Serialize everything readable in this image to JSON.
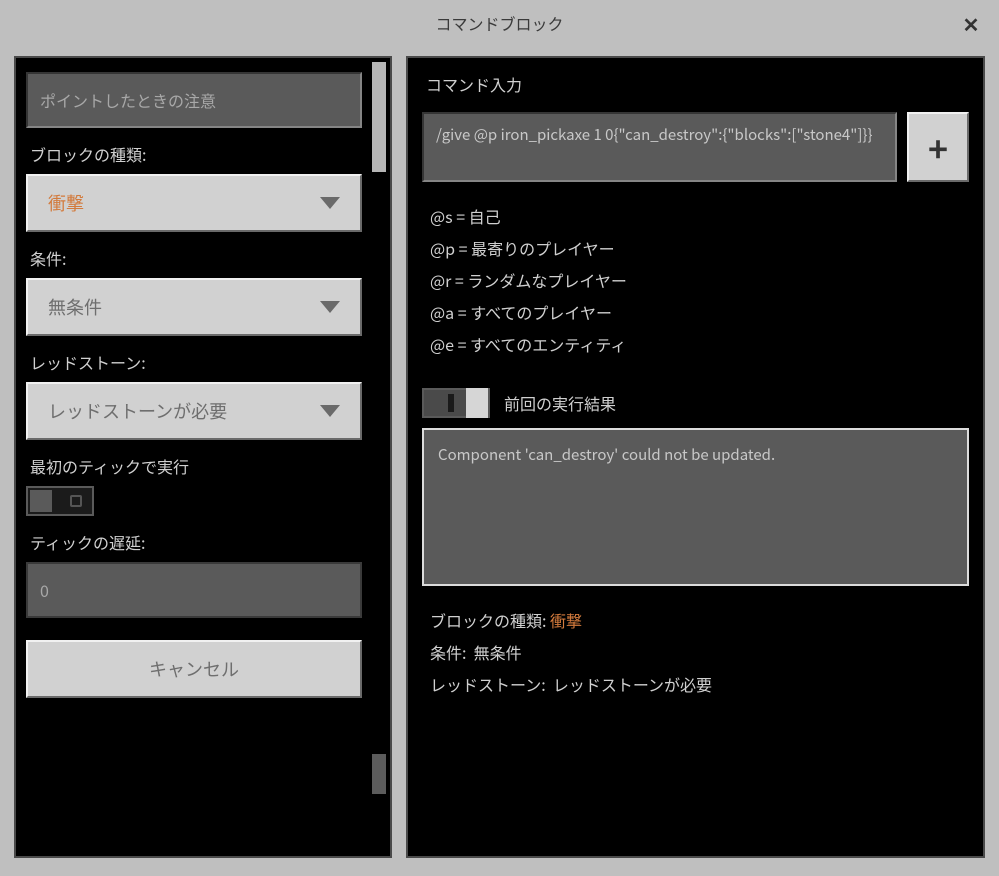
{
  "window": {
    "title": "コマンドブロック"
  },
  "left": {
    "hover_note_placeholder": "ポイントしたときの注意",
    "block_type_label": "ブロックの種類:",
    "block_type_value": "衝撃",
    "condition_label": "条件:",
    "condition_value": "無条件",
    "redstone_label": "レッドストーン:",
    "redstone_value": "レッドストーンが必要",
    "execute_first_tick_label": "最初のティックで実行",
    "tick_delay_label": "ティックの遅延:",
    "tick_delay_value": "0",
    "cancel_label": "キャンセル"
  },
  "right": {
    "command_input_label": "コマンド入力",
    "command_value": "/give @p iron_pickaxe 1 0{\"can_destroy\":{\"blocks\":[\"stone4\"]}}",
    "plus_label": "+",
    "selectors": {
      "s": "@s = 自己",
      "p": "@p = 最寄りのプレイヤー",
      "r": "@r = ランダムなプレイヤー",
      "a": "@a = すべてのプレイヤー",
      "e": "@e = すべてのエンティティ"
    },
    "last_result_label": "前回の実行結果",
    "last_result_text": "Component 'can_destroy' could not be updated.",
    "status": {
      "block_type_label": "ブロックの種類:",
      "block_type_value": "衝撃",
      "condition_label": "条件:",
      "condition_value": "無条件",
      "redstone_label": "レッドストーン:",
      "redstone_value": "レッドストーンが必要"
    }
  }
}
